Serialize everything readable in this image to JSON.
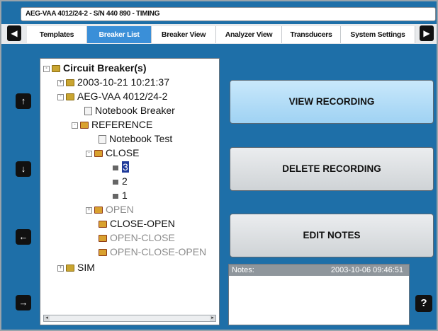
{
  "window": {
    "title": "AEG-VAA 4012/24-2 - S/N 440 890 - TIMING"
  },
  "tabs": [
    {
      "label": "Templates"
    },
    {
      "label": "Breaker List"
    },
    {
      "label": "Breaker View"
    },
    {
      "label": "Analyzer View"
    },
    {
      "label": "Transducers"
    },
    {
      "label": "System Settings"
    }
  ],
  "active_tab": "Breaker List",
  "tree": {
    "root": "Circuit Breaker(s)",
    "items": [
      {
        "label": "2003-10-21 10:21:37"
      },
      {
        "label": "AEG-VAA 4012/24-2"
      },
      {
        "label": "Notebook Breaker"
      },
      {
        "label": "REFERENCE"
      },
      {
        "label": "Notebook Test"
      },
      {
        "label": "CLOSE"
      },
      {
        "label": "3"
      },
      {
        "label": "2"
      },
      {
        "label": "1"
      },
      {
        "label": "OPEN"
      },
      {
        "label": "CLOSE-OPEN"
      },
      {
        "label": "OPEN-CLOSE"
      },
      {
        "label": "OPEN-CLOSE-OPEN"
      },
      {
        "label": "SIM"
      }
    ]
  },
  "actions": {
    "view": "VIEW RECORDING",
    "delete": "DELETE RECORDING",
    "edit": "EDIT NOTES"
  },
  "notes": {
    "label": "Notes:",
    "timestamp": "2003-10-06 09:46:51",
    "text": ""
  },
  "icons": {
    "prev_tab": "left-triangle-icon",
    "next_tab": "right-triangle-icon",
    "up": "arrow-up-icon",
    "down": "arrow-down-icon",
    "left": "arrow-left-icon",
    "right": "arrow-right-icon",
    "help": "question-icon"
  },
  "colors": {
    "background": "#1e6fa8",
    "active_tab": "#3a8fd8",
    "primary_button": "#b4def8"
  }
}
